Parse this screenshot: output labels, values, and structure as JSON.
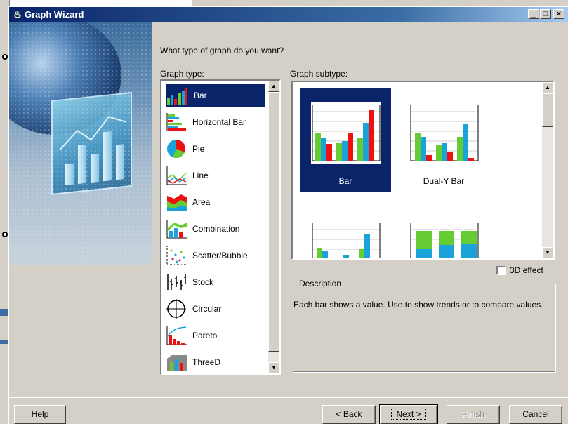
{
  "window": {
    "title": "Graph Wizard",
    "minimize": "_",
    "maximize": "□",
    "close": "×"
  },
  "question": "What type of graph do you want?",
  "graph_type_label": "Graph type:",
  "graph_subtype_label": "Graph subtype:",
  "graph_types": [
    {
      "label": "Bar",
      "icon": "bar-chart-icon",
      "selected": true
    },
    {
      "label": "Horizontal Bar",
      "icon": "horizontal-bar-chart-icon"
    },
    {
      "label": "Pie",
      "icon": "pie-chart-icon"
    },
    {
      "label": "Line",
      "icon": "line-chart-icon"
    },
    {
      "label": "Area",
      "icon": "area-chart-icon"
    },
    {
      "label": "Combination",
      "icon": "combination-chart-icon"
    },
    {
      "label": "Scatter/Bubble",
      "icon": "scatter-chart-icon"
    },
    {
      "label": "Stock",
      "icon": "stock-chart-icon"
    },
    {
      "label": "Circular",
      "icon": "circular-chart-icon"
    },
    {
      "label": "Pareto",
      "icon": "pareto-chart-icon"
    },
    {
      "label": "ThreeD",
      "icon": "threed-chart-icon"
    }
  ],
  "graph_subtypes": [
    {
      "label": "Bar",
      "selected": true
    },
    {
      "label": "Dual-Y Bar"
    },
    {
      "label": ""
    },
    {
      "label": ""
    }
  ],
  "effect_3d": {
    "label": "3D effect",
    "checked": false
  },
  "description": {
    "legend": "Description",
    "text": "Each bar shows a value. Use to show trends or to compare values."
  },
  "buttons": {
    "help": "Help",
    "back": "< Back",
    "next": "Next >",
    "finish": "Finish",
    "cancel": "Cancel"
  },
  "colors": {
    "selection": "#0a246a",
    "green": "#66cc33",
    "cyan": "#1aa3d9",
    "red": "#ee1111"
  }
}
